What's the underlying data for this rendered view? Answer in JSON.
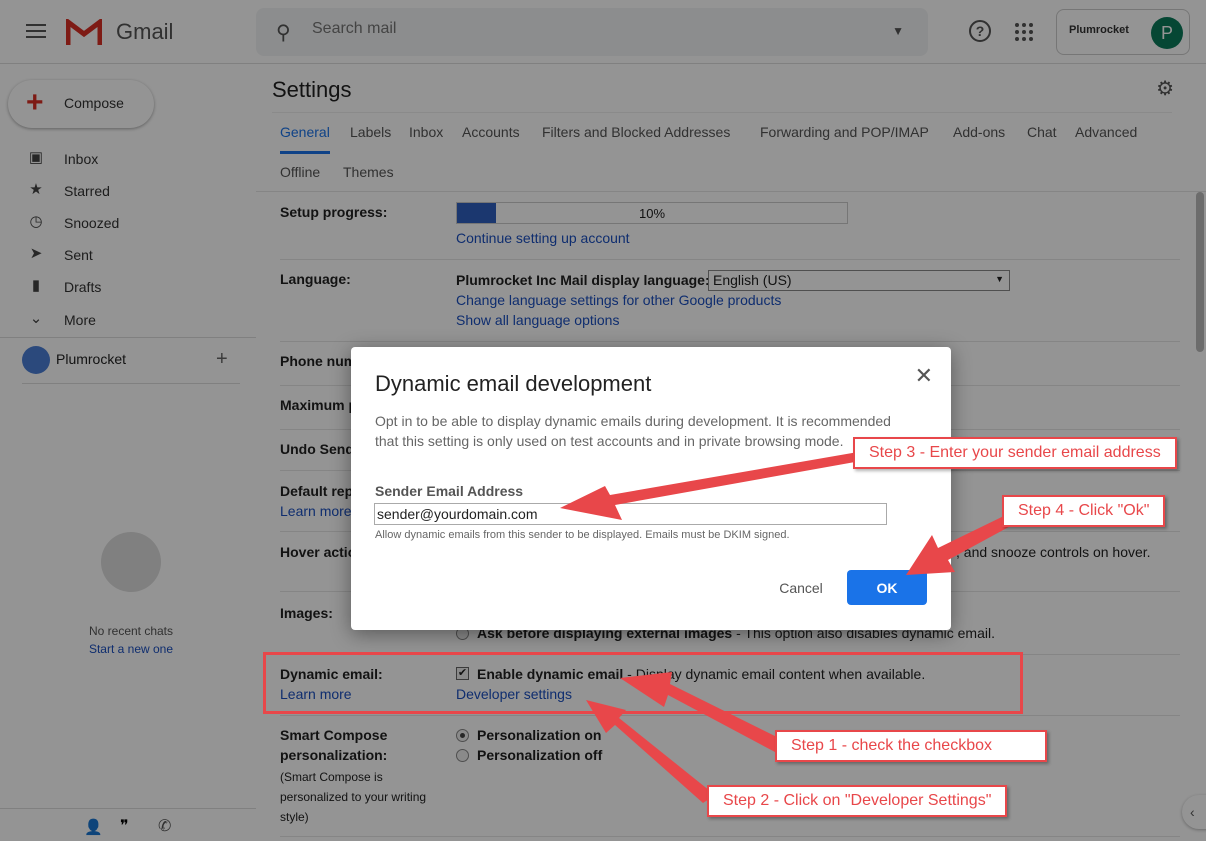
{
  "topbar": {
    "app_name": "Gmail",
    "search_placeholder": "Search mail",
    "account_brand": "Plumrocket",
    "avatar_letter": "P"
  },
  "sidebar": {
    "compose": "Compose",
    "items": [
      {
        "label": "Inbox",
        "icon": "inbox-icon"
      },
      {
        "label": "Starred",
        "icon": "star-icon"
      },
      {
        "label": "Snoozed",
        "icon": "clock-icon"
      },
      {
        "label": "Sent",
        "icon": "send-icon"
      },
      {
        "label": "Drafts",
        "icon": "file-icon"
      },
      {
        "label": "More",
        "icon": "chevron-down-icon"
      }
    ],
    "user": "Plumrocket",
    "no_chats": "No recent chats",
    "start_new": "Start a new one"
  },
  "settings": {
    "title": "Settings",
    "tabs": [
      "General",
      "Labels",
      "Inbox",
      "Accounts",
      "Filters and Blocked Addresses",
      "Forwarding and POP/IMAP",
      "Add-ons",
      "Chat",
      "Advanced",
      "Offline",
      "Themes"
    ],
    "setup_progress": {
      "label": "Setup progress:",
      "percent": 10,
      "percent_text": "10%",
      "link": "Continue setting up account"
    },
    "language": {
      "label": "Language:",
      "display_label": "Plumrocket Inc Mail display language:",
      "selected": "English (US)",
      "link1": "Change language settings for other Google products",
      "link2": "Show all language options"
    },
    "rows": [
      "Phone num",
      "Maximum p",
      "Undo Send",
      "Default rep",
      "Hover actio",
      "Images:"
    ],
    "default_reply_link": "Learn more",
    "hover_text": ", and snooze controls on hover.",
    "images_option_bold": "Ask before displaying external images",
    "images_option_text": " - This option also disables dynamic email.",
    "dynamic": {
      "label": "Dynamic email:",
      "learn_more": "Learn more",
      "checkbox_label": "Enable dynamic email",
      "checkbox_desc": " - Display dynamic email content when available.",
      "checked": true,
      "dev_link": "Developer settings"
    },
    "smart": {
      "label1": "Smart Compose",
      "label2": "personalization:",
      "note": "(Smart Compose is personalized to your writing style)",
      "on": "Personalization on",
      "off": "Personalization off",
      "selected": "on"
    }
  },
  "modal": {
    "title": "Dynamic email development",
    "description": "Opt in to be able to display dynamic emails during development. It is recommended that this setting is only used on test accounts and in private browsing mode.",
    "field_label": "Sender Email Address",
    "field_value": "sender@yourdomain.com",
    "hint": "Allow dynamic emails from this sender to be displayed. Emails must be DKIM signed.",
    "cancel": "Cancel",
    "ok": "OK"
  },
  "annotations": {
    "step1": "Step 1 - check the checkbox",
    "step2": "Step 2 - Click on \"Developer Settings\"",
    "step3": "Step 3 - Enter your sender email address",
    "step4": "Step 4 - Click \"Ok\"",
    "color": "#e8474a"
  },
  "colors": {
    "accent": "#1a73e8",
    "link": "#1a4fbf",
    "avatar": "#0b7a5b"
  }
}
